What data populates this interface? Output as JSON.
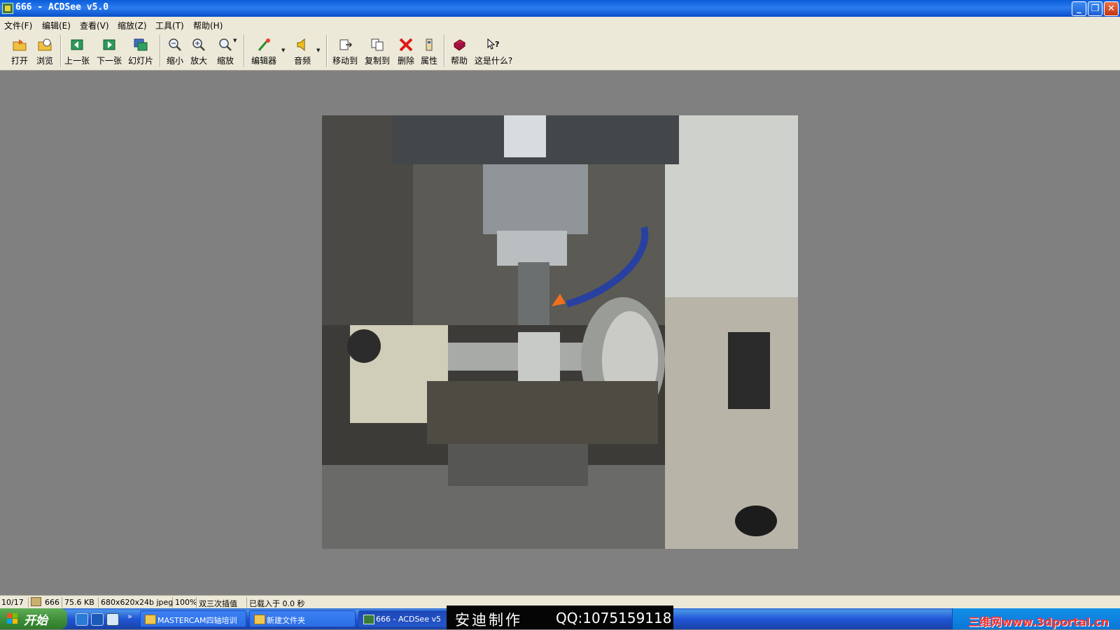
{
  "window": {
    "title": "666 - ACDSee v5.0"
  },
  "menu": [
    "文件(F)",
    "编辑(E)",
    "查看(V)",
    "缩放(Z)",
    "工具(T)",
    "帮助(H)"
  ],
  "toolbar": {
    "open": "打开",
    "browse": "浏览",
    "prev": "上一张",
    "next": "下一张",
    "slideshow": "幻灯片",
    "zoom_out": "缩小",
    "zoom_in": "放大",
    "zoom": "缩放",
    "editor": "编辑器",
    "audio": "音频",
    "move_to": "移动到",
    "copy_to": "复制到",
    "delete": "删除",
    "properties": "属性",
    "help": "帮助",
    "whats_this": "这是什么?"
  },
  "status": {
    "index": "10/17",
    "filename": "666",
    "filesize": "75.6 KB",
    "dimensions": "680x620x24b jpeg",
    "zoom": "100%",
    "interpolation": "双三次插值",
    "load_time": "已载入于 0.0 秒"
  },
  "taskbar": {
    "start": "开始",
    "tasks": [
      "MASTERCAM四轴培训",
      "新建文件夹",
      "666 - ACDSee v5"
    ],
    "overlay_left": "安迪制作",
    "overlay_right": "QQ:1075159118",
    "watermark": "三维网www.3dportal.cn"
  },
  "colors": {
    "titlebar": "#0a5cd8",
    "taskbar": "#2157d7",
    "start": "#3c8b36",
    "viewer_bg": "#808080"
  }
}
